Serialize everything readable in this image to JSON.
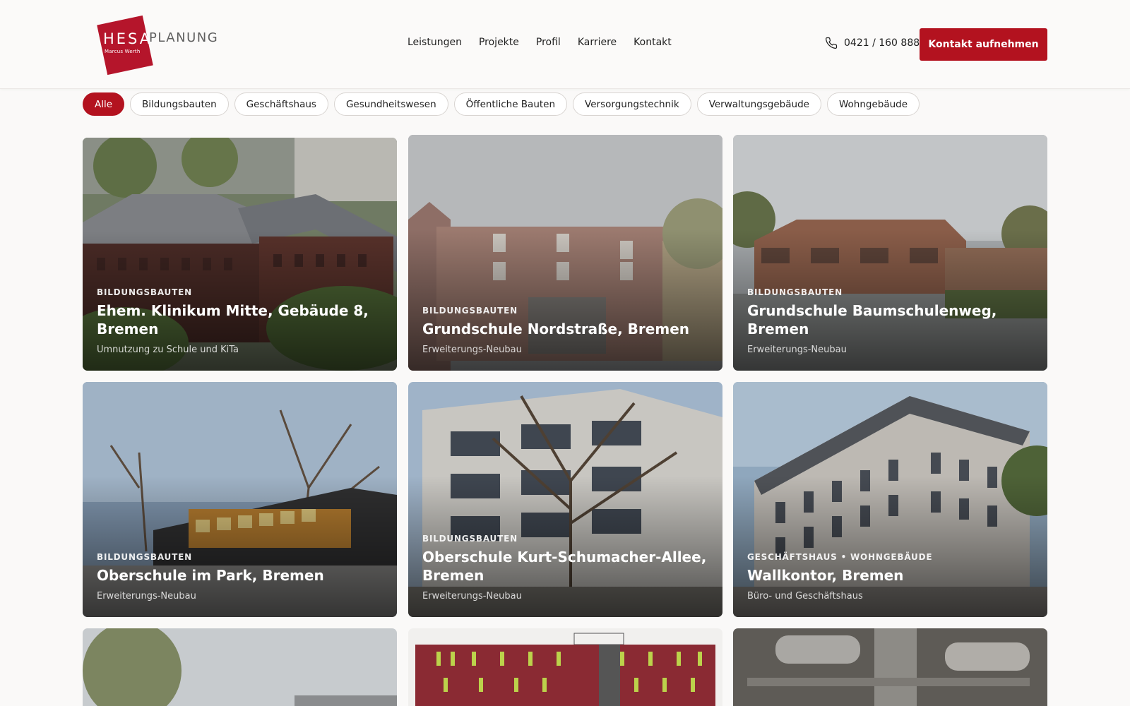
{
  "brand": {
    "logo_hesa": "HESA",
    "logo_sub": "Marcus Werth",
    "logo_planung": "PLANUNG",
    "accent": "#b3121f"
  },
  "nav": {
    "items": [
      "Leistungen",
      "Projekte",
      "Profil",
      "Karriere",
      "Kontakt"
    ]
  },
  "header": {
    "phone_icon": "phone-icon",
    "phone": "0421 / 160 888",
    "cta_label": "Kontakt aufnehmen"
  },
  "filters": {
    "items": [
      "Alle",
      "Bildungsbauten",
      "Geschäftshaus",
      "Gesundheitswesen",
      "Öffentliche Bauten",
      "Versorgungstechnik",
      "Verwaltungsgebäude",
      "Wohngebäude"
    ],
    "active": "Alle"
  },
  "projects": [
    {
      "category": "BILDUNGSBAUTEN",
      "title": "Ehem. Klinikum Mitte, Gebäude 8, Bremen",
      "subtitle": "Umnutzung zu Schule und KiTa"
    },
    {
      "category": "BILDUNGSBAUTEN",
      "title": "Grundschule Nordstraße, Bremen",
      "subtitle": "Erweiterungs-Neubau"
    },
    {
      "category": "BILDUNGSBAUTEN",
      "title": "Grundschule Baumschulenweg, Bremen",
      "subtitle": "Erweiterungs-Neubau"
    },
    {
      "category": "BILDUNGSBAUTEN",
      "title": "Oberschule im Park, Bremen",
      "subtitle": "Erweiterungs-Neubau"
    },
    {
      "category": "BILDUNGSBAUTEN",
      "title": "Oberschule Kurt-Schumacher-Allee, Bremen",
      "subtitle": "Erweiterungs-Neubau"
    },
    {
      "category": "GESCHÄFTSHAUS • WOHNGEBÄUDE",
      "title": "Wallkontor, Bremen",
      "subtitle": "Büro- und Geschäftshaus"
    }
  ]
}
